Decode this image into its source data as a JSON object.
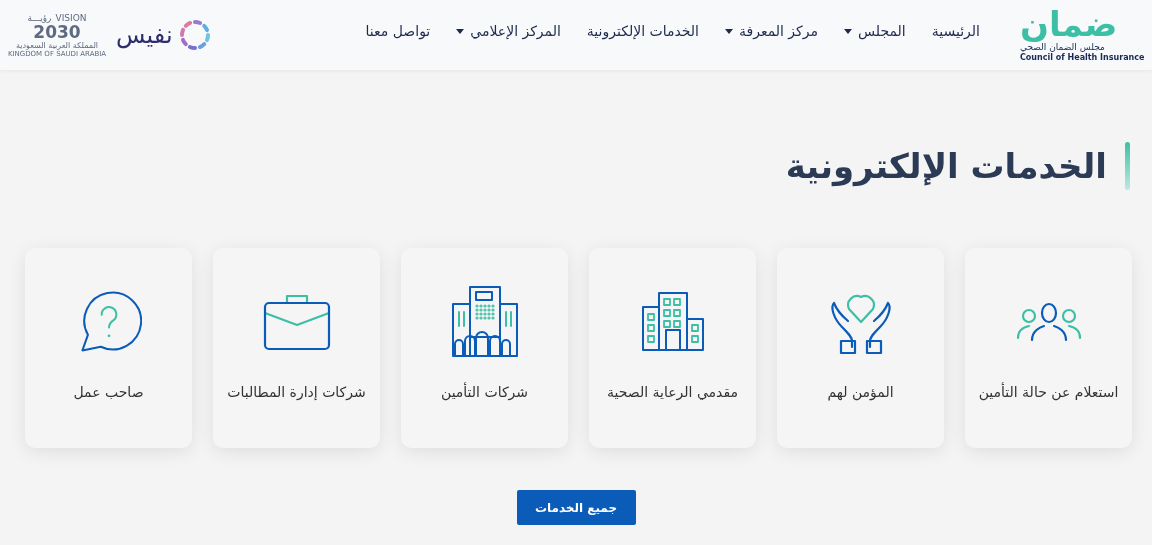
{
  "header": {
    "logo": {
      "wordmark": "ضمان",
      "name_ar": "مجلس الضمان الصحي",
      "name_en": "Council of Health Insurance"
    },
    "nav": [
      {
        "label": "الرئيسية",
        "dropdown": false
      },
      {
        "label": "المجلس",
        "dropdown": true
      },
      {
        "label": "مركز المعرفة",
        "dropdown": true
      },
      {
        "label": "الخدمات الإلكترونية",
        "dropdown": false
      },
      {
        "label": "المركز الإعلامي",
        "dropdown": true
      },
      {
        "label": "تواصل معنا",
        "dropdown": false
      }
    ],
    "partner_logo": {
      "wordmark": "نفيس"
    },
    "vision_logo": {
      "top_en": "VISION",
      "top_ar": "رؤيـــة",
      "year": "2030",
      "country_ar": "المملكة العربية السعودية",
      "country_en": "KINGDOM OF SAUDI ARABIA"
    }
  },
  "page_title": "الخدمات الإلكترونية",
  "services": [
    {
      "kind": "people",
      "label": "استعلام عن حالة التأمين"
    },
    {
      "kind": "care",
      "label": "المؤمن لهم"
    },
    {
      "kind": "hospital",
      "label": "مقدمي الرعاية الصحية"
    },
    {
      "kind": "insurer",
      "label": "شركات التأمين"
    },
    {
      "kind": "briefcase",
      "label": "شركات إدارة المطالبات"
    },
    {
      "kind": "question",
      "label": "صاحب عمل"
    }
  ],
  "all_services_button": "جميع الخدمات"
}
